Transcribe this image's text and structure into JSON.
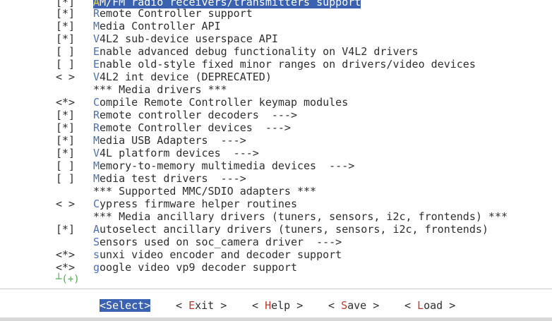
{
  "menu": {
    "items": [
      {
        "mark": "[*]",
        "hot": "A",
        "rest": "M/FM radio receivers/transmitters support",
        "selected": true
      },
      {
        "mark": "[*]",
        "hot": "R",
        "rest": "emote Controller support"
      },
      {
        "mark": "[*]",
        "hot": "M",
        "rest": "edia Controller API"
      },
      {
        "mark": "[*]",
        "hot": "V",
        "rest": "4L2 sub-device userspace API"
      },
      {
        "mark": "[ ]",
        "hot": "E",
        "rest": "nable advanced debug functionality on V4L2 drivers"
      },
      {
        "mark": "[ ]",
        "hot": "E",
        "rest": "nable old-style fixed minor ranges on drivers/video devices"
      },
      {
        "mark": "< >",
        "hot": "V",
        "rest": "4L2 int device (DEPRECATED)"
      },
      {
        "mark": "",
        "hot": "",
        "rest": "*** Media drivers ***"
      },
      {
        "mark": "<*>",
        "hot": "C",
        "rest": "ompile Remote Controller keymap modules"
      },
      {
        "mark": "[*]",
        "hot": "R",
        "rest": "emote controller decoders  --->"
      },
      {
        "mark": "[*]",
        "hot": "R",
        "rest": "emote Controller devices  --->"
      },
      {
        "mark": "[*]",
        "hot": "M",
        "rest": "edia USB Adapters  --->"
      },
      {
        "mark": "[*]",
        "hot": "V",
        "rest": "4L platform devices  --->"
      },
      {
        "mark": "[ ]",
        "hot": "M",
        "rest": "emory-to-memory multimedia devices  --->"
      },
      {
        "mark": "[ ]",
        "hot": "M",
        "rest": "edia test drivers  --->"
      },
      {
        "mark": "",
        "hot": "",
        "rest": "*** Supported MMC/SDIO adapters ***"
      },
      {
        "mark": "< >",
        "hot": "C",
        "rest": "ypress firmware helper routines"
      },
      {
        "mark": "",
        "hot": "",
        "rest": "*** Media ancillary drivers (tuners, sensors, i2c, frontends) ***"
      },
      {
        "mark": "[*]",
        "hot": "A",
        "rest": "utoselect ancillary drivers (tuners, sensors, i2c, frontends)"
      },
      {
        "mark": "",
        "hot": "S",
        "rest": "ensors used on soc_camera driver  --->"
      },
      {
        "mark": "<*>",
        "hot": "s",
        "rest": "unxi video encoder and decoder support"
      },
      {
        "mark": "<*>",
        "hot": "g",
        "rest": "oogle video vp9 decoder support"
      }
    ],
    "more_indicator": "┴(+)"
  },
  "buttons": [
    {
      "pre": "<",
      "hk": "S",
      "post": "elect>",
      "active": true
    },
    {
      "pre": "< ",
      "hk": "E",
      "post": "xit >",
      "active": false
    },
    {
      "pre": "< ",
      "hk": "H",
      "post": "elp >",
      "active": false
    },
    {
      "pre": "< ",
      "hk": "S",
      "post": "ave >",
      "active": false
    },
    {
      "pre": "< ",
      "hk": "L",
      "post": "oad >",
      "active": false
    }
  ],
  "colors": {
    "selection": "#3a62b0",
    "hotkey": "#4a70b8",
    "button_hotkey": "#c0392b",
    "more_indicator": "#4caf50"
  }
}
